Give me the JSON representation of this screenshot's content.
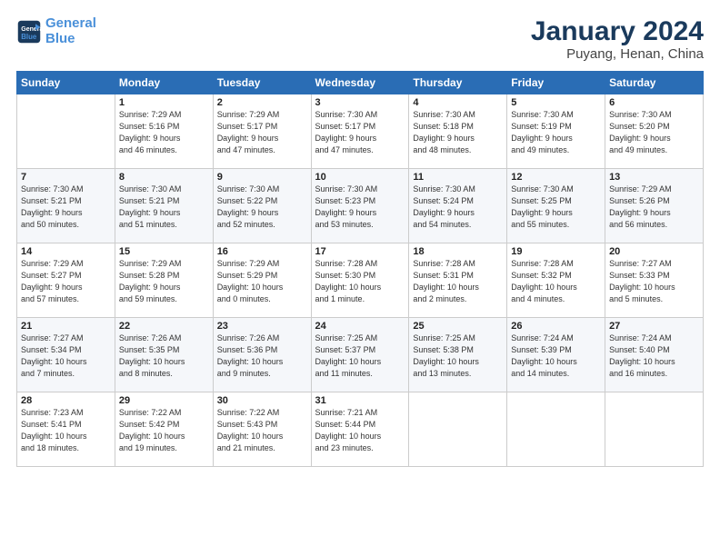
{
  "logo": {
    "line1": "General",
    "line2": "Blue"
  },
  "header": {
    "month": "January 2024",
    "location": "Puyang, Henan, China"
  },
  "weekdays": [
    "Sunday",
    "Monday",
    "Tuesday",
    "Wednesday",
    "Thursday",
    "Friday",
    "Saturday"
  ],
  "weeks": [
    [
      {
        "day": "",
        "info": ""
      },
      {
        "day": "1",
        "info": "Sunrise: 7:29 AM\nSunset: 5:16 PM\nDaylight: 9 hours\nand 46 minutes."
      },
      {
        "day": "2",
        "info": "Sunrise: 7:29 AM\nSunset: 5:17 PM\nDaylight: 9 hours\nand 47 minutes."
      },
      {
        "day": "3",
        "info": "Sunrise: 7:30 AM\nSunset: 5:17 PM\nDaylight: 9 hours\nand 47 minutes."
      },
      {
        "day": "4",
        "info": "Sunrise: 7:30 AM\nSunset: 5:18 PM\nDaylight: 9 hours\nand 48 minutes."
      },
      {
        "day": "5",
        "info": "Sunrise: 7:30 AM\nSunset: 5:19 PM\nDaylight: 9 hours\nand 49 minutes."
      },
      {
        "day": "6",
        "info": "Sunrise: 7:30 AM\nSunset: 5:20 PM\nDaylight: 9 hours\nand 49 minutes."
      }
    ],
    [
      {
        "day": "7",
        "info": "Sunrise: 7:30 AM\nSunset: 5:21 PM\nDaylight: 9 hours\nand 50 minutes."
      },
      {
        "day": "8",
        "info": "Sunrise: 7:30 AM\nSunset: 5:21 PM\nDaylight: 9 hours\nand 51 minutes."
      },
      {
        "day": "9",
        "info": "Sunrise: 7:30 AM\nSunset: 5:22 PM\nDaylight: 9 hours\nand 52 minutes."
      },
      {
        "day": "10",
        "info": "Sunrise: 7:30 AM\nSunset: 5:23 PM\nDaylight: 9 hours\nand 53 minutes."
      },
      {
        "day": "11",
        "info": "Sunrise: 7:30 AM\nSunset: 5:24 PM\nDaylight: 9 hours\nand 54 minutes."
      },
      {
        "day": "12",
        "info": "Sunrise: 7:30 AM\nSunset: 5:25 PM\nDaylight: 9 hours\nand 55 minutes."
      },
      {
        "day": "13",
        "info": "Sunrise: 7:29 AM\nSunset: 5:26 PM\nDaylight: 9 hours\nand 56 minutes."
      }
    ],
    [
      {
        "day": "14",
        "info": "Sunrise: 7:29 AM\nSunset: 5:27 PM\nDaylight: 9 hours\nand 57 minutes."
      },
      {
        "day": "15",
        "info": "Sunrise: 7:29 AM\nSunset: 5:28 PM\nDaylight: 9 hours\nand 59 minutes."
      },
      {
        "day": "16",
        "info": "Sunrise: 7:29 AM\nSunset: 5:29 PM\nDaylight: 10 hours\nand 0 minutes."
      },
      {
        "day": "17",
        "info": "Sunrise: 7:28 AM\nSunset: 5:30 PM\nDaylight: 10 hours\nand 1 minute."
      },
      {
        "day": "18",
        "info": "Sunrise: 7:28 AM\nSunset: 5:31 PM\nDaylight: 10 hours\nand 2 minutes."
      },
      {
        "day": "19",
        "info": "Sunrise: 7:28 AM\nSunset: 5:32 PM\nDaylight: 10 hours\nand 4 minutes."
      },
      {
        "day": "20",
        "info": "Sunrise: 7:27 AM\nSunset: 5:33 PM\nDaylight: 10 hours\nand 5 minutes."
      }
    ],
    [
      {
        "day": "21",
        "info": "Sunrise: 7:27 AM\nSunset: 5:34 PM\nDaylight: 10 hours\nand 7 minutes."
      },
      {
        "day": "22",
        "info": "Sunrise: 7:26 AM\nSunset: 5:35 PM\nDaylight: 10 hours\nand 8 minutes."
      },
      {
        "day": "23",
        "info": "Sunrise: 7:26 AM\nSunset: 5:36 PM\nDaylight: 10 hours\nand 9 minutes."
      },
      {
        "day": "24",
        "info": "Sunrise: 7:25 AM\nSunset: 5:37 PM\nDaylight: 10 hours\nand 11 minutes."
      },
      {
        "day": "25",
        "info": "Sunrise: 7:25 AM\nSunset: 5:38 PM\nDaylight: 10 hours\nand 13 minutes."
      },
      {
        "day": "26",
        "info": "Sunrise: 7:24 AM\nSunset: 5:39 PM\nDaylight: 10 hours\nand 14 minutes."
      },
      {
        "day": "27",
        "info": "Sunrise: 7:24 AM\nSunset: 5:40 PM\nDaylight: 10 hours\nand 16 minutes."
      }
    ],
    [
      {
        "day": "28",
        "info": "Sunrise: 7:23 AM\nSunset: 5:41 PM\nDaylight: 10 hours\nand 18 minutes."
      },
      {
        "day": "29",
        "info": "Sunrise: 7:22 AM\nSunset: 5:42 PM\nDaylight: 10 hours\nand 19 minutes."
      },
      {
        "day": "30",
        "info": "Sunrise: 7:22 AM\nSunset: 5:43 PM\nDaylight: 10 hours\nand 21 minutes."
      },
      {
        "day": "31",
        "info": "Sunrise: 7:21 AM\nSunset: 5:44 PM\nDaylight: 10 hours\nand 23 minutes."
      },
      {
        "day": "",
        "info": ""
      },
      {
        "day": "",
        "info": ""
      },
      {
        "day": "",
        "info": ""
      }
    ]
  ]
}
